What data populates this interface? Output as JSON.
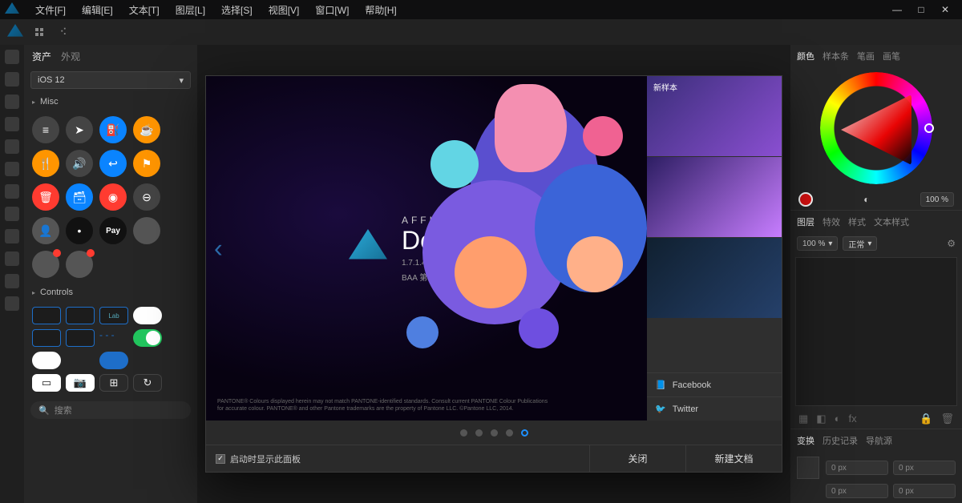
{
  "menu": {
    "items": [
      "文件[F]",
      "编辑[E]",
      "文本[T]",
      "图层[L]",
      "选择[S]",
      "视图[V]",
      "窗口[W]",
      "帮助[H]"
    ]
  },
  "window_controls": {
    "min": "—",
    "max": "□",
    "close": "✕"
  },
  "left_panel": {
    "tabs": [
      "资产",
      "外观"
    ],
    "active_tab": "资产",
    "preset": "iOS 12",
    "section_misc": "Misc",
    "section_controls": "Controls",
    "assets": [
      {
        "color": "#444",
        "glyph": "≡"
      },
      {
        "color": "#444",
        "glyph": "➤"
      },
      {
        "color": "#0a84ff",
        "glyph": "⛽"
      },
      {
        "color": "#ff9500",
        "glyph": "☕"
      },
      null,
      {
        "color": "#ff9500",
        "glyph": "🍴"
      },
      {
        "color": "#444",
        "glyph": "🔊"
      },
      {
        "color": "#0a84ff",
        "glyph": "↩"
      },
      {
        "color": "#ff9500",
        "glyph": "⚑"
      },
      null,
      {
        "color": "#ff3b30",
        "glyph": "🗑"
      },
      {
        "color": "#0a84ff",
        "glyph": "🗃"
      },
      {
        "color": "#ff3b30",
        "glyph": "◉"
      },
      {
        "color": "#444",
        "glyph": "⊖"
      },
      null,
      {
        "color": "#555",
        "glyph": "👤"
      },
      {
        "color": "#111",
        "glyph": "•"
      },
      {
        "color": "#111",
        "glyph": "Pay",
        "text": true
      },
      {
        "color": "#555",
        "glyph": ""
      },
      null,
      {
        "color": "#555",
        "glyph": "",
        "badge": true
      },
      {
        "color": "#555",
        "glyph": "",
        "badge": true
      },
      null,
      null,
      null
    ],
    "search_placeholder": "搜索"
  },
  "splash": {
    "brand": "AFFINITY",
    "product": "Designer",
    "version": "1.7.1.404",
    "edition": "BAA 第三方测试版",
    "pantone": "PANTONE® Colours displayed herein may not match PANTONE-identified standards. Consult current PANTONE Colour Publications for accurate colour. PANTONE® and other Pantone trademarks are the property of Pantone LLC. ©Pantone LLC, 2014.",
    "side_label": "新样本",
    "social": {
      "facebook": "Facebook",
      "twitter": "Twitter"
    },
    "checkbox": "启动时显示此面板",
    "close_btn": "关闭",
    "new_btn": "新建文档"
  },
  "right_panel": {
    "tabs_top": [
      "颜色",
      "样本条",
      "笔画",
      "画笔"
    ],
    "opacity_icon": "◐",
    "opacity_value": "100 %",
    "tabs_layers": [
      "图层",
      "特效",
      "样式",
      "文本样式"
    ],
    "layer_opacity": "100 %",
    "layer_blend": "正常",
    "tabs_bottom": [
      "变换",
      "历史记录",
      "导航源"
    ],
    "px_x": "0 px",
    "px_y": "0 px",
    "px_w": "0 px",
    "px_h": "0 px"
  }
}
